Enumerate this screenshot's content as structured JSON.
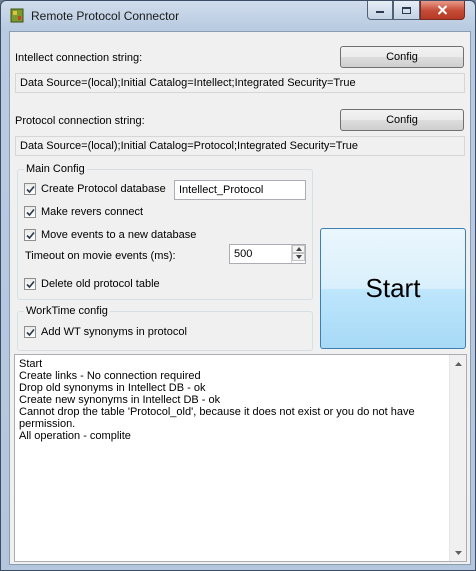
{
  "window": {
    "title": "Remote Protocol Connector",
    "icons": {
      "app": "app-icon",
      "minimize": "minimize-icon",
      "maximize": "maximize-icon",
      "close": "close-icon"
    }
  },
  "intellect": {
    "label": "Intellect connection string:",
    "config_label": "Config",
    "value": "Data Source=(local);Initial Catalog=Intellect;Integrated Security=True"
  },
  "protocol": {
    "label": "Protocol connection string:",
    "config_label": "Config",
    "value": "Data Source=(local);Initial Catalog=Protocol;Integrated Security=True"
  },
  "main_config": {
    "title": "Main Config",
    "create_db": {
      "label": "Create Protocol database",
      "checked": true,
      "db_name": "Intellect_Protocol"
    },
    "revers": {
      "label": "Make revers connect",
      "checked": true
    },
    "move_events": {
      "label": "Move events to a new database",
      "checked": true
    },
    "timeout": {
      "label": "Timeout on movie events (ms):",
      "value": "500"
    },
    "delete_old": {
      "label": "Delete old protocol table",
      "checked": true
    }
  },
  "worktime_config": {
    "title": "WorkTime config",
    "wt_synonyms": {
      "label": "Add WT synonyms in protocol",
      "checked": true
    }
  },
  "start_button": {
    "label": "Start"
  },
  "log": {
    "lines": [
      "Start",
      "Create links - No connection required",
      "Drop old synonyms in Intellect DB - ok",
      "Create new synonyms in Intellect DB - ok",
      "Cannot drop the table 'Protocol_old', because it does not exist or you do not have permission.",
      "All operation - complite"
    ]
  },
  "colors": {
    "accent": "#3c7fb1",
    "close": "#c44a35",
    "background": "#f0f0f0"
  }
}
